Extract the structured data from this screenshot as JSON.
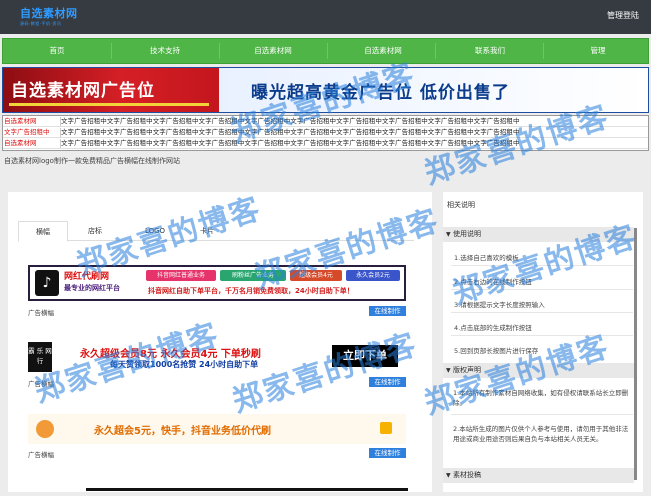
{
  "header": {
    "logo_main": "自选素材网",
    "logo_sub": "源码·教程·手机·资讯",
    "login": "管理登陆"
  },
  "nav": [
    "首页",
    "技术支持",
    "自选素材网",
    "自选素材网",
    "联系我们",
    "管理"
  ],
  "banner": {
    "left": "自选素材网广告位",
    "right": "曝光超高黄金广告位 低价出售了"
  },
  "text_ads": {
    "rows": [
      {
        "first": "自选素材网",
        "first_color": "#d11",
        "rest": "文字广告招租中文字广告招租中文字广告招租中文字广告招租中文字广告招租中文字广告招租中文字广告招租中文字广告招租中文字广告招租中文字广告招租中"
      },
      {
        "first": "文字广告招租中",
        "first_color": "#d11",
        "rest": "文字广告招租中文字广告招租中文字广告招租中文字广告招租中文字广告招租中文字广告招租中文字广告招租中文字广告招租中文字广告招租中文字广告招租中"
      },
      {
        "first": "自选素材网",
        "first_color": "#d11",
        "rest": "文字广告招租中文字广告招租中文字广告招租中文字广告招租中文字广告招租中文字广告招租中文字广告招租中文字广告招租中文字广告招租中文字广告招租中"
      }
    ]
  },
  "tagline": "自选素材网logo制作一款免费精品广告横幅在线制作网站",
  "tabs": [
    "横幅",
    "店标",
    "LOGO",
    "卡片"
  ],
  "ads": [
    {
      "caption": "广告横幅",
      "button": "在线制作",
      "title": "网红代刷网",
      "subtitle": "最专业的网红平台",
      "pills": [
        "抖音网红普通业务",
        "刷粉丝广告业务",
        "超级会员4元",
        "永久会员2元"
      ],
      "slogan": "抖音网红自助下单平台，千万名月销免费领取，24小时自助下单！"
    },
    {
      "caption": "广告横幅",
      "button": "在线制作",
      "logo": "霸 乐 网 行",
      "line1": "永久超级会员8元 永久会员4元 下单秒刷",
      "line2": "每天赞领取1000名抢赞 24小时自助下单",
      "cta": "立即下单"
    },
    {
      "caption": "广告横幅",
      "button": "在线制作",
      "text": "永久超会5元，快手，抖音业务低价代刷"
    }
  ],
  "sidebar": {
    "title": "相关说明",
    "sections": [
      {
        "head": "使用说明",
        "steps": [
          "1.选择自己喜欢的模板",
          "2.点击右边的在线制作按钮",
          "3.请根据提示文字长度按照输入",
          "4.点击底部的生成制作按钮",
          "5.回到页部长按图片进行保存"
        ]
      },
      {
        "head": "版权声明",
        "notes": [
          "1.本站所有制作素材自网络收集，如有侵权请联系站长立即删除。",
          "2.本站所生成的图片仅供个人参考与使用，请勿用于其他非法用途或商业用途否则后果自负与本站相关人员无关。"
        ]
      },
      {
        "head": "素材投稿"
      }
    ]
  },
  "watermark": "郑家喜的博客",
  "colors": {
    "topbar": "#363b42",
    "nav": "#4fb547",
    "button": "#2f7fdc",
    "banner_red": "#d51f26",
    "banner_blue": "#0b3c8c"
  }
}
